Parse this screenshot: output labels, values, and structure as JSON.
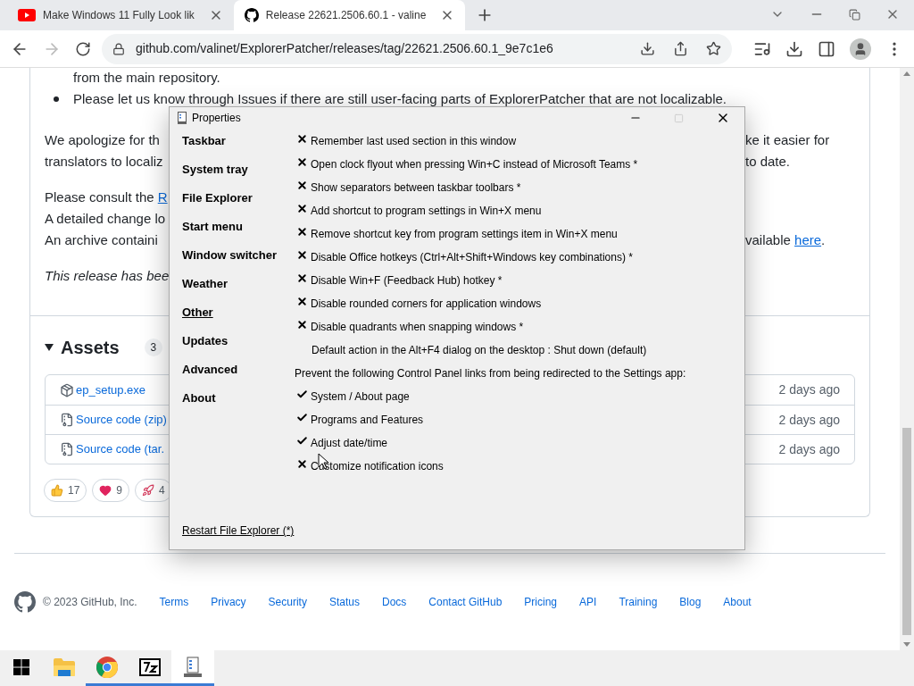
{
  "browser": {
    "tabs": [
      {
        "title": "Make Windows 11 Fully Look lik",
        "kind": "video",
        "selected": false
      },
      {
        "title": "Release 22621.2506.60.1 - valine",
        "kind": "github",
        "selected": true
      }
    ],
    "url": "github.com/valinet/ExplorerPatcher/releases/tag/22621.2506.60.1_9e7c1e6"
  },
  "page": {
    "bullet_continuation": "from the main repository.",
    "bullet": "Please let us know through Issues if there are still user-facing parts of ExplorerPatcher that are not localizable.",
    "lines": [
      {
        "left": "We apologize for th",
        "right": "ke it easier for"
      },
      {
        "left": "translators to localiz",
        "right": "to date."
      }
    ],
    "consult": {
      "text": "Please consult the ",
      "link": "R"
    },
    "change_log": "A detailed change lo",
    "archive": {
      "left": "An archive containi",
      "right": "vailable ",
      "link": "here",
      "end": "."
    },
    "note": "This release has bee",
    "assets": {
      "title": "Assets",
      "count": "3",
      "expanded": true,
      "rows": [
        {
          "kind": "package",
          "name": "ep_setup.exe",
          "date": "2 days ago"
        },
        {
          "kind": "zip",
          "name": "Source code (zip)",
          "date": "2 days ago"
        },
        {
          "kind": "zip",
          "name": "Source code (tar.",
          "date": "2 days ago"
        }
      ]
    },
    "reactions": [
      {
        "kind": "thumbs",
        "count": "17"
      },
      {
        "kind": "heart",
        "count": "9"
      },
      {
        "kind": "rocket",
        "count": "4"
      }
    ],
    "footer": {
      "copyright": "© 2023 GitHub, Inc.",
      "links": [
        "Terms",
        "Privacy",
        "Security",
        "Status",
        "Docs",
        "Contact GitHub",
        "Pricing",
        "API",
        "Training",
        "Blog",
        "About"
      ]
    }
  },
  "dialog": {
    "title": "Properties",
    "sections": [
      {
        "label": "Taskbar",
        "selected": false
      },
      {
        "label": "System tray",
        "selected": false
      },
      {
        "label": "File Explorer",
        "selected": false
      },
      {
        "label": "Start menu",
        "selected": false
      },
      {
        "label": "Window switcher",
        "selected": false
      },
      {
        "label": "Weather",
        "selected": false
      },
      {
        "label": "Other",
        "selected": true
      },
      {
        "label": "Updates",
        "selected": false
      },
      {
        "label": "Advanced",
        "selected": false
      },
      {
        "label": "About",
        "selected": false
      }
    ],
    "options": [
      {
        "kind": "toggle",
        "checked": false,
        "label": "Remember last used section in this window"
      },
      {
        "kind": "toggle",
        "checked": false,
        "label": "Open clock flyout when pressing Win+C instead of Microsoft Teams *"
      },
      {
        "kind": "toggle",
        "checked": false,
        "label": "Show separators between taskbar toolbars *"
      },
      {
        "kind": "toggle",
        "checked": false,
        "label": "Add shortcut to program settings in Win+X menu"
      },
      {
        "kind": "toggle",
        "checked": false,
        "label": "Remove shortcut key from program settings item in Win+X menu"
      },
      {
        "kind": "toggle",
        "checked": false,
        "label": "Disable Office hotkeys (Ctrl+Alt+Shift+Windows key combinations) *"
      },
      {
        "kind": "toggle",
        "checked": false,
        "label": "Disable Win+F (Feedback Hub) hotkey *"
      },
      {
        "kind": "toggle",
        "checked": false,
        "label": "Disable rounded corners for application windows"
      },
      {
        "kind": "toggle",
        "checked": false,
        "label": "Disable quadrants when snapping windows *"
      },
      {
        "kind": "setting",
        "label": "Default action in the Alt+F4 dialog on the desktop : Shut down (default)"
      },
      {
        "kind": "heading",
        "label": "Prevent the following Control Panel links from being redirected to the Settings app:"
      },
      {
        "kind": "toggle",
        "checked": true,
        "label": "System / About page"
      },
      {
        "kind": "toggle",
        "checked": true,
        "label": "Programs and Features"
      },
      {
        "kind": "toggle",
        "checked": true,
        "label": "Adjust date/time"
      },
      {
        "kind": "toggle",
        "checked": false,
        "label": "Customize notification icons"
      }
    ],
    "restart_link": "Restart File Explorer (*)"
  },
  "taskbar": [
    {
      "kind": "start",
      "running": false,
      "selected": false
    },
    {
      "kind": "folder",
      "running": false,
      "selected": false
    },
    {
      "kind": "chrome",
      "running": true,
      "selected": false
    },
    {
      "kind": "archiver",
      "running": true,
      "selected": false
    },
    {
      "kind": "properties",
      "running": true,
      "selected": true
    }
  ]
}
